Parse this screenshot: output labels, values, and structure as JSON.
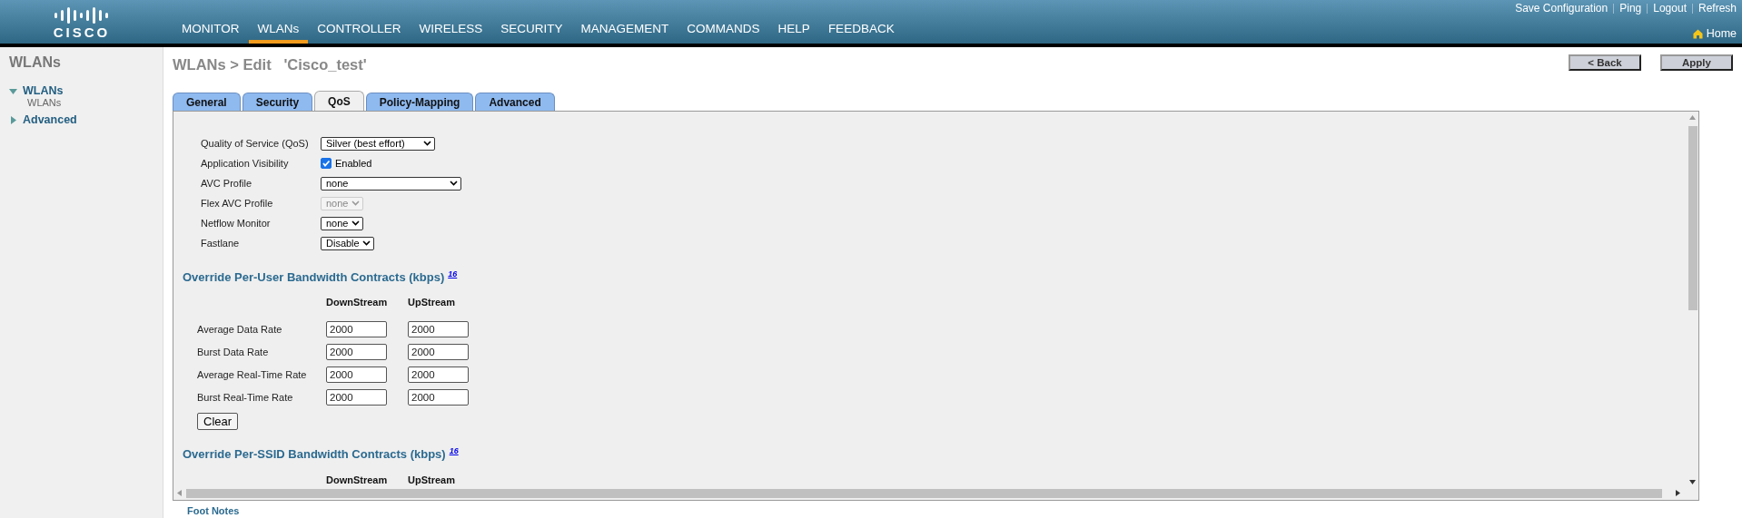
{
  "header": {
    "nav": [
      {
        "label": "MONITOR",
        "selected": false
      },
      {
        "label": "WLANs",
        "selected": true
      },
      {
        "label": "CONTROLLER",
        "selected": false
      },
      {
        "label": "WIRELESS",
        "selected": false
      },
      {
        "label": "SECURITY",
        "selected": false
      },
      {
        "label": "MANAGEMENT",
        "selected": false
      },
      {
        "label": "COMMANDS",
        "selected": false
      },
      {
        "label": "HELP",
        "selected": false
      },
      {
        "label": "FEEDBACK",
        "selected": false
      }
    ],
    "links": [
      "Save Configuration",
      "Ping",
      "Logout",
      "Refresh"
    ],
    "home": "Home",
    "logo": "CISCO"
  },
  "sidebar": {
    "title": "WLANs",
    "tree": [
      {
        "label": "WLANs",
        "expanded": true,
        "children": [
          {
            "label": "WLANs"
          }
        ]
      },
      {
        "label": "Advanced",
        "expanded": false
      }
    ]
  },
  "page": {
    "title": "WLANs > Edit   'Cisco_test'",
    "buttons": [
      "< Back",
      "Apply"
    ]
  },
  "tabs": [
    {
      "label": "General",
      "selected": false
    },
    {
      "label": "Security",
      "selected": false
    },
    {
      "label": "QoS",
      "selected": true
    },
    {
      "label": "Policy-Mapping",
      "selected": false
    },
    {
      "label": "Advanced",
      "selected": false
    }
  ],
  "fields": [
    {
      "label": "Quality of Service (QoS)",
      "kind": "select",
      "value": "Silver (best effort)",
      "disabled": false
    },
    {
      "label": "Application Visibility",
      "kind": "checkbox",
      "checked": true,
      "text": "Enabled"
    },
    {
      "label": "AVC Profile",
      "kind": "select",
      "value": "none",
      "disabled": false
    },
    {
      "label": "Flex AVC Profile",
      "kind": "select",
      "value": "none",
      "disabled": true
    },
    {
      "label": "Netflow Monitor",
      "kind": "select",
      "value": "none",
      "disabled": false
    },
    {
      "label": "Fastlane",
      "kind": "select",
      "value": "Disable",
      "disabled": false
    }
  ],
  "sections": [
    {
      "heading": "Override Per-User Bandwidth Contracts (kbps)",
      "note": "16",
      "columns": [
        "DownStream",
        "UpStream"
      ],
      "rows": [
        {
          "label": "Average Data Rate",
          "values": [
            "2000",
            "2000"
          ]
        },
        {
          "label": "Burst Data Rate",
          "values": [
            "2000",
            "2000"
          ]
        },
        {
          "label": "Average Real-Time Rate",
          "values": [
            "2000",
            "2000"
          ]
        },
        {
          "label": "Burst Real-Time Rate",
          "values": [
            "2000",
            "2000"
          ]
        }
      ],
      "button": "Clear"
    },
    {
      "heading": "Override Per-SSID Bandwidth Contracts (kbps)",
      "note": "16",
      "columns": [
        "DownStream",
        "UpStream"
      ]
    }
  ],
  "footer": "Foot Notes"
}
